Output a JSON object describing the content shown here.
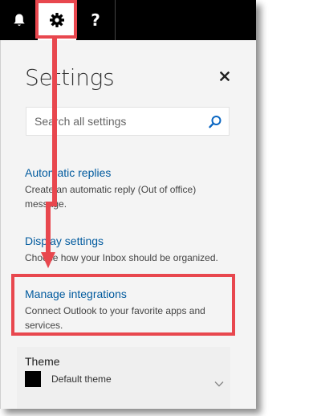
{
  "toolbar": {
    "bell_icon": "bell-icon",
    "gear_icon": "gear-icon",
    "help_label": "?"
  },
  "settings": {
    "title": "Settings",
    "close_icon": "close-icon",
    "search": {
      "placeholder": "Search all settings",
      "icon": "search-icon"
    },
    "sections": [
      {
        "link": "Automatic replies",
        "description": "Create an automatic reply (Out of office) message."
      },
      {
        "link": "Display settings",
        "description": "Choose how your Inbox should be organized."
      },
      {
        "link": "Manage integrations",
        "description": "Connect Outlook to your favorite apps and services."
      }
    ],
    "theme": {
      "label": "Theme",
      "value": "Default theme",
      "swatch_color": "#000000"
    }
  },
  "colors": {
    "link": "#005a9e",
    "annotation": "#e8474e",
    "toolbar_bg": "#000000",
    "panel_bg": "#f4f4f4"
  }
}
